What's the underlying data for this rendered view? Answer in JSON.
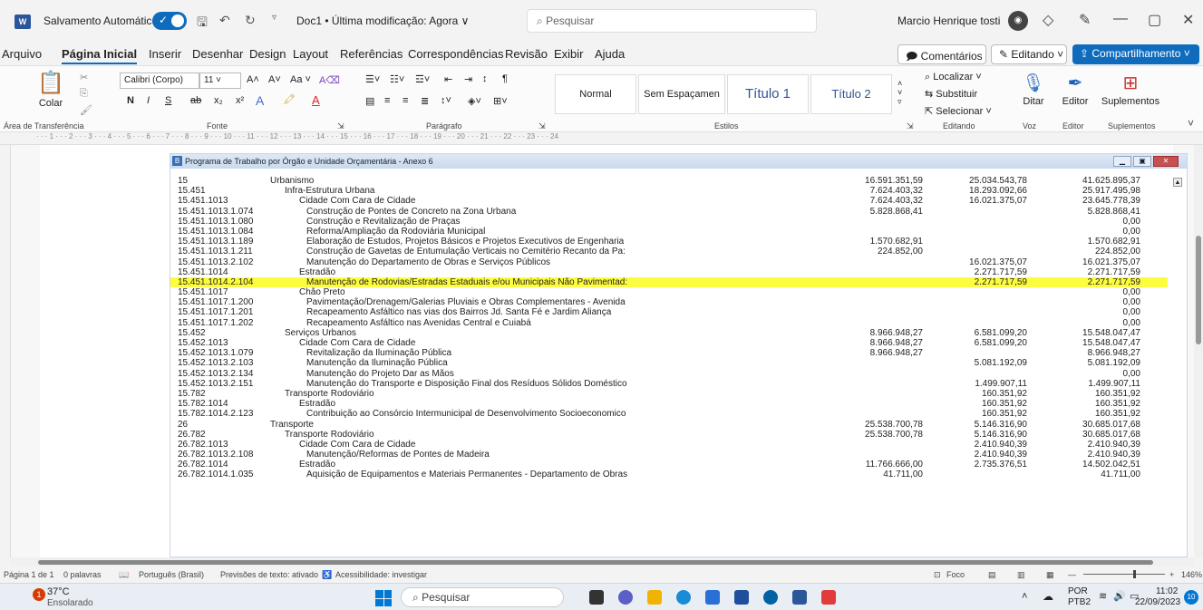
{
  "titlebar": {
    "app_icon": "W",
    "autosave_label": "Salvamento Automático",
    "doc_title": "Doc1 • Última modificação: Agora ∨",
    "search_placeholder": "Pesquisar",
    "user_name": "Marcio Henrique tosti"
  },
  "menu": {
    "items": [
      "Arquivo",
      "Página Inicial",
      "Inserir",
      "Desenhar",
      "Design",
      "Layout",
      "Referências",
      "Correspondências",
      "Revisão",
      "Exibir",
      "Ajuda"
    ],
    "comments_label": "Comentários",
    "editing_label": "Editando ˅",
    "share_label": "Compartilhamento ˅"
  },
  "ribbon": {
    "paste_label": "Colar",
    "font_name": "Calibri (Corpo)",
    "font_size": "11",
    "group_clipboard": "Área de Transferência",
    "group_font": "Fonte",
    "group_paragraph": "Parágrafo",
    "group_styles": "Estilos",
    "group_editing": "Editando",
    "group_voice": "Voz",
    "group_editor": "Editor",
    "group_addins": "Suplementos",
    "styles": [
      "Normal",
      "Sem Espaçamen",
      "Título 1",
      "Título 2"
    ],
    "find_label": "Localizar",
    "replace_label": "Substituir",
    "select_label": "Selecionar",
    "dictate_label": "Ditar",
    "editor_label": "Editor",
    "addins_label": "Suplementos",
    "format_buttons": [
      "N",
      "I",
      "S",
      "ab",
      "x₂",
      "x²"
    ]
  },
  "ruler_text": "· · · 1 · · · 2 · · · 3 · · · 4 · · · 5 · · · 6 · · · 7 · · · 8 · · · 9 · · · 10 · · · 11 · · · 12 · · · 13 · · · 14 · · · 15 · · · 16 · · · 17 · · · 18 · · · 19 · · · 20 · · · 21 · · · 22 · · · 23 · · · 24",
  "embedded": {
    "title": "Programa de Trabalho por Órgão e Unidade Orçamentária - Anexo 6",
    "rows": [
      {
        "code": "15",
        "indent": 0,
        "desc": "Urbanismo",
        "v1": "16.591.351,59",
        "v2": "25.034.543,78",
        "v3": "41.625.895,37"
      },
      {
        "code": "15.451",
        "indent": 1,
        "desc": "Infra-Estrutura Urbana",
        "v1": "7.624.403,32",
        "v2": "18.293.092,66",
        "v3": "25.917.495,98"
      },
      {
        "code": "15.451.1013",
        "indent": 2,
        "desc": "Cidade Com Cara de Cidade",
        "v1": "7.624.403,32",
        "v2": "16.021.375,07",
        "v3": "23.645.778,39"
      },
      {
        "code": "15.451.1013.1.074",
        "indent": 3,
        "desc": "Construção de Pontes de Concreto na Zona Urbana",
        "v1": "5.828.868,41",
        "v2": "",
        "v3": "5.828.868,41"
      },
      {
        "code": "15.451.1013.1.080",
        "indent": 3,
        "desc": "Construção e Revitalização de Praças",
        "v1": "",
        "v2": "",
        "v3": "0,00"
      },
      {
        "code": "15.451.1013.1.084",
        "indent": 3,
        "desc": "Reforma/Ampliação da Rodoviária Municipal",
        "v1": "",
        "v2": "",
        "v3": "0,00"
      },
      {
        "code": "15.451.1013.1.189",
        "indent": 3,
        "desc": "Elaboração de Estudos, Projetos Básicos e Projetos Executivos de Engenharia",
        "v1": "1.570.682,91",
        "v2": "",
        "v3": "1.570.682,91"
      },
      {
        "code": "15.451.1013.1.211",
        "indent": 3,
        "desc": "Construção de Gavetas de Entumulação Verticais no Cemitério Recanto da Pa:",
        "v1": "224.852,00",
        "v2": "",
        "v3": "224.852,00"
      },
      {
        "code": "15.451.1013.2.102",
        "indent": 3,
        "desc": "Manutenção do Departamento de Obras e Serviços Públicos",
        "v1": "",
        "v2": "16.021.375,07",
        "v3": "16.021.375,07"
      },
      {
        "code": "15.451.1014",
        "indent": 2,
        "desc": "Estradão",
        "v1": "",
        "v2": "2.271.717,59",
        "v3": "2.271.717,59"
      },
      {
        "code": "15.451.1014.2.104",
        "indent": 3,
        "desc": "Manutenção de Rodovias/Estradas Estaduais e/ou Municipais Não Pavimentad:",
        "v1": "",
        "v2": "2.271.717,59",
        "v3": "2.271.717,59",
        "highlight": true
      },
      {
        "code": "15.451.1017",
        "indent": 2,
        "desc": "Chão Preto",
        "v1": "",
        "v2": "",
        "v3": "0,00"
      },
      {
        "code": "15.451.1017.1.200",
        "indent": 3,
        "desc": "Pavimentação/Drenagem/Galerias Pluviais e Obras Complementares - Avenida",
        "v1": "",
        "v2": "",
        "v3": "0,00"
      },
      {
        "code": "15.451.1017.1.201",
        "indent": 3,
        "desc": "Recapeamento Asfáltico nas vias dos Bairros Jd. Santa Fé e Jardim Aliança",
        "v1": "",
        "v2": "",
        "v3": "0,00"
      },
      {
        "code": "15.451.1017.1.202",
        "indent": 3,
        "desc": "Recapeamento Asfáltico nas Avenidas Central e Cuiabá",
        "v1": "",
        "v2": "",
        "v3": "0,00"
      },
      {
        "code": "15.452",
        "indent": 1,
        "desc": "Serviços Urbanos",
        "v1": "8.966.948,27",
        "v2": "6.581.099,20",
        "v3": "15.548.047,47"
      },
      {
        "code": "15.452.1013",
        "indent": 2,
        "desc": "Cidade Com Cara de Cidade",
        "v1": "8.966.948,27",
        "v2": "6.581.099,20",
        "v3": "15.548.047,47"
      },
      {
        "code": "15.452.1013.1.079",
        "indent": 3,
        "desc": "Revitalização da Iluminação Pública",
        "v1": "8.966.948,27",
        "v2": "",
        "v3": "8.966.948,27"
      },
      {
        "code": "15.452.1013.2.103",
        "indent": 3,
        "desc": "Manutenção da Iluminação Pública",
        "v1": "",
        "v2": "5.081.192,09",
        "v3": "5.081.192,09"
      },
      {
        "code": "15.452.1013.2.134",
        "indent": 3,
        "desc": "Manutenção do Projeto Dar as Mãos",
        "v1": "",
        "v2": "",
        "v3": "0,00"
      },
      {
        "code": "15.452.1013.2.151",
        "indent": 3,
        "desc": "Manutenção do Transporte e Disposição Final dos Resíduos Sólidos Doméstico",
        "v1": "",
        "v2": "1.499.907,11",
        "v3": "1.499.907,11"
      },
      {
        "code": "15.782",
        "indent": 1,
        "desc": "Transporte Rodoviário",
        "v1": "",
        "v2": "160.351,92",
        "v3": "160.351,92"
      },
      {
        "code": "15.782.1014",
        "indent": 2,
        "desc": "Estradão",
        "v1": "",
        "v2": "160.351,92",
        "v3": "160.351,92"
      },
      {
        "code": "15.782.1014.2.123",
        "indent": 3,
        "desc": "Contribuição ao Consórcio Intermunicipal de Desenvolvimento Socioeconomico",
        "v1": "",
        "v2": "160.351,92",
        "v3": "160.351,92"
      },
      {
        "code": "26",
        "indent": 0,
        "desc": "Transporte",
        "v1": "25.538.700,78",
        "v2": "5.146.316,90",
        "v3": "30.685.017,68"
      },
      {
        "code": "26.782",
        "indent": 1,
        "desc": "Transporte Rodoviário",
        "v1": "25.538.700,78",
        "v2": "5.146.316,90",
        "v3": "30.685.017,68"
      },
      {
        "code": "26.782.1013",
        "indent": 2,
        "desc": "Cidade Com Cara de Cidade",
        "v1": "",
        "v2": "2.410.940,39",
        "v3": "2.410.940,39"
      },
      {
        "code": "26.782.1013.2.108",
        "indent": 3,
        "desc": "Manutenção/Reformas de Pontes de Madeira",
        "v1": "",
        "v2": "2.410.940,39",
        "v3": "2.410.940,39"
      },
      {
        "code": "26.782.1014",
        "indent": 2,
        "desc": "Estradão",
        "v1": "11.766.666,00",
        "v2": "2.735.376,51",
        "v3": "14.502.042,51"
      },
      {
        "code": "26.782.1014.1.035",
        "indent": 3,
        "desc": "Aquisição de Equipamentos e Materiais Permanentes - Departamento de Obras",
        "v1": "41.711,00",
        "v2": "",
        "v3": "41.711,00"
      }
    ]
  },
  "status": {
    "page": "Página 1 de 1",
    "words": "0 palavras",
    "language": "Português (Brasil)",
    "predictions": "Previsões de texto: ativado",
    "accessibility": "Acessibilidade: investigar",
    "focus": "Foco",
    "zoom": "146%"
  },
  "taskbar": {
    "weather_temp": "37°C",
    "weather_desc": "Ensolarado",
    "weather_badge": "1",
    "search": "Pesquisar",
    "lang": "POR",
    "layout": "PTB2",
    "time": "11:02",
    "date": "22/09/2023",
    "notif": "10"
  }
}
